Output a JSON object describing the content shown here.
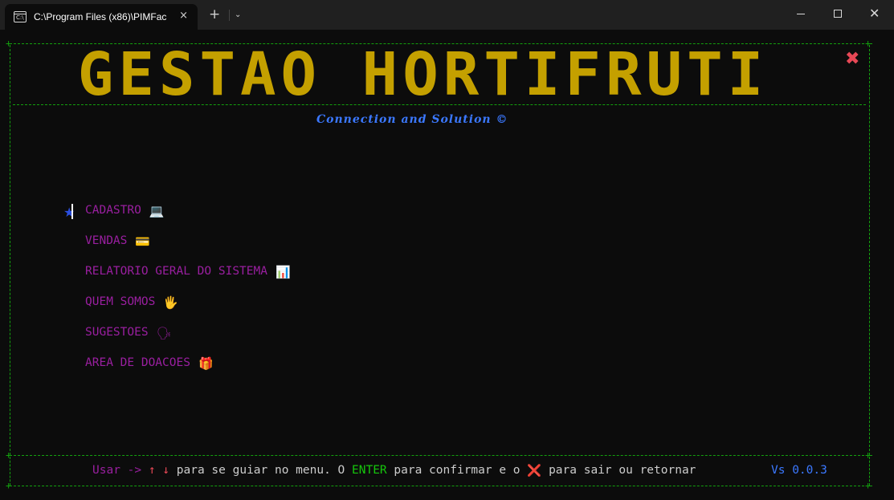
{
  "window": {
    "tab_title": "C:\\Program Files (x86)\\PIMFac",
    "tab_close_glyph": "×",
    "new_tab_glyph": "+",
    "dropdown_glyph": "⌄",
    "close_glyph": "✕"
  },
  "banner": {
    "title": "GESTAO HORTIFRUTI",
    "color": "#c4a000"
  },
  "exit_glyph": "✖",
  "subtitle": "Connection and Solution ©",
  "menu": {
    "cursor_glyph": "★",
    "items": [
      {
        "label": "CADASTRO",
        "emoji": "💻"
      },
      {
        "label": "VENDAS",
        "emoji": "💳"
      },
      {
        "label": "RELATORIO GERAL DO SISTEMA",
        "emoji": "📊"
      },
      {
        "label": "QUEM SOMOS",
        "emoji": "🖐"
      },
      {
        "label": "SUGESTOES",
        "emoji": "🗣"
      },
      {
        "label": "AREA DE DOACOES",
        "emoji": "🎁"
      }
    ]
  },
  "footer": {
    "usar": "Usar -> ",
    "arrows": "↑ ↓ ",
    "text1": "para se guiar no menu. O ",
    "enter": "ENTER ",
    "text2": "para confirmar e o ",
    "x_glyph": "❌ ",
    "text3": "para sair ou retornar",
    "version": "Vs 0.0.3"
  },
  "colors": {
    "frame": "#13a10e",
    "menu_text": "#9a1fa0",
    "accent_blue": "#3b78ff",
    "red": "#e74856",
    "green": "#16c60c"
  }
}
